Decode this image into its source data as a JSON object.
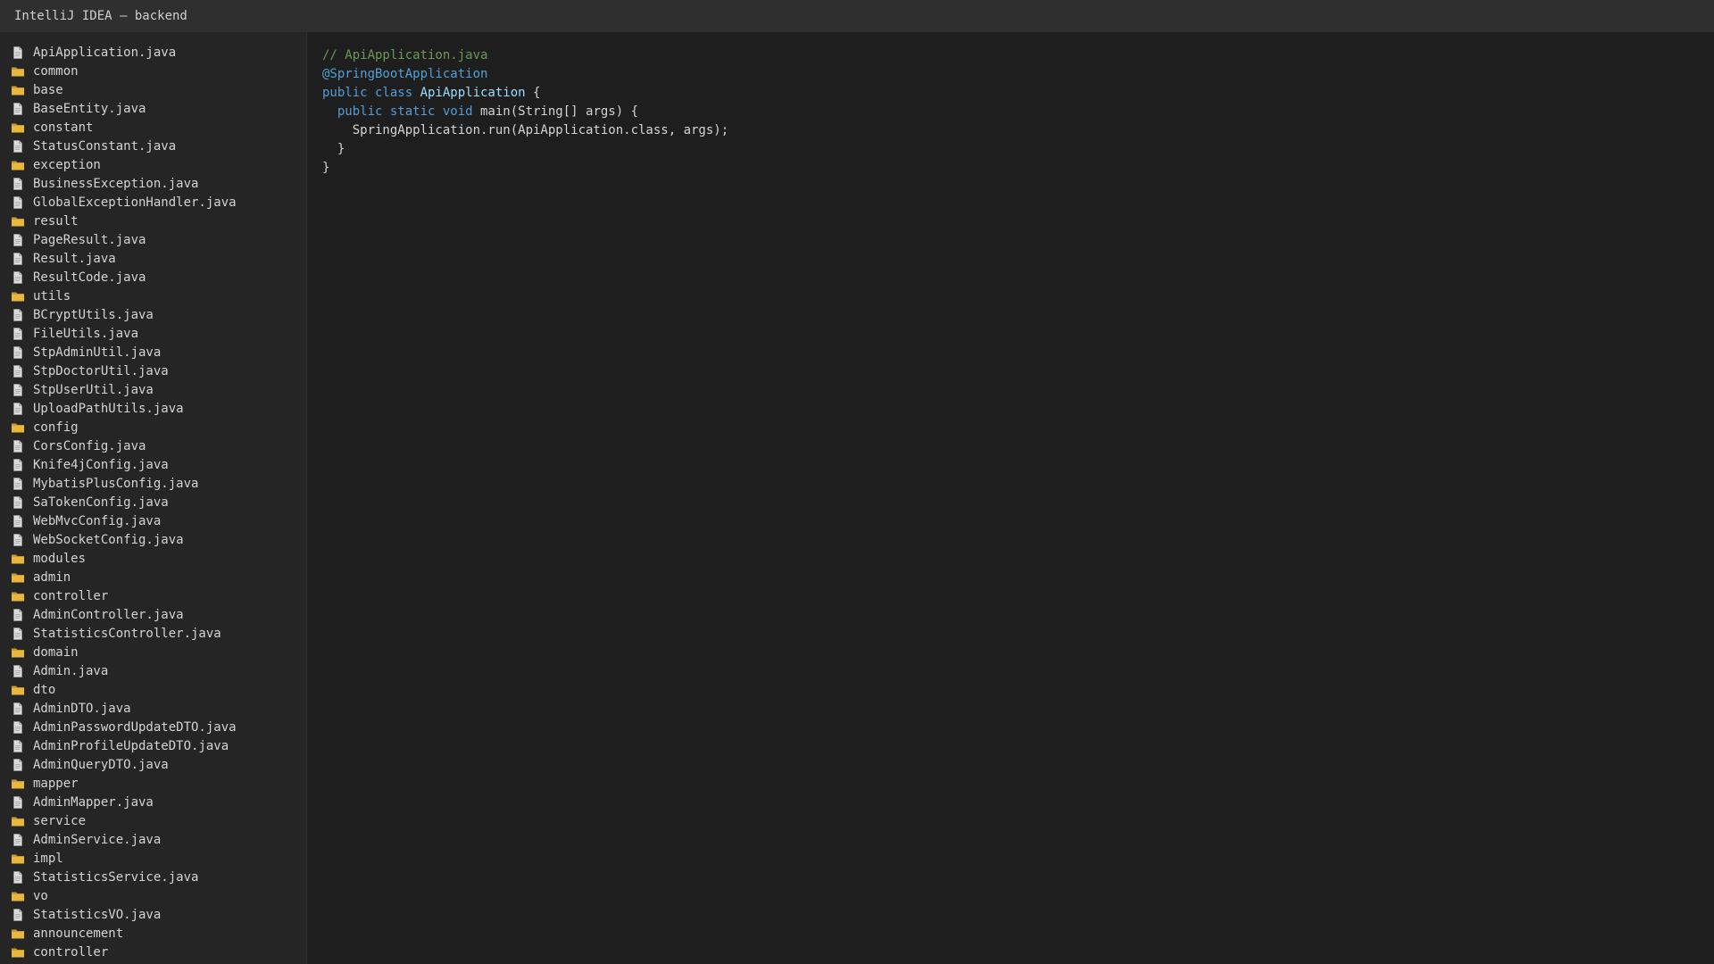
{
  "window": {
    "title": "IntelliJ IDEA — backend"
  },
  "icons": {
    "file": "file-icon",
    "folder": "folder-icon"
  },
  "colors": {
    "folder": "#e8b73c",
    "file": "#dcdcdc",
    "comment": "#6a9955",
    "annotation": "#4fa1d8",
    "keyword": "#569cd6",
    "class_name": "#9cdcfe"
  },
  "sidebar": {
    "items": [
      {
        "type": "file",
        "label": "ApiApplication.java"
      },
      {
        "type": "folder",
        "label": "common"
      },
      {
        "type": "folder",
        "label": "base"
      },
      {
        "type": "file",
        "label": "BaseEntity.java"
      },
      {
        "type": "folder",
        "label": "constant"
      },
      {
        "type": "file",
        "label": "StatusConstant.java"
      },
      {
        "type": "folder",
        "label": "exception"
      },
      {
        "type": "file",
        "label": "BusinessException.java"
      },
      {
        "type": "file",
        "label": "GlobalExceptionHandler.java"
      },
      {
        "type": "folder",
        "label": "result"
      },
      {
        "type": "file",
        "label": "PageResult.java"
      },
      {
        "type": "file",
        "label": "Result.java"
      },
      {
        "type": "file",
        "label": "ResultCode.java"
      },
      {
        "type": "folder",
        "label": "utils"
      },
      {
        "type": "file",
        "label": "BCryptUtils.java"
      },
      {
        "type": "file",
        "label": "FileUtils.java"
      },
      {
        "type": "file",
        "label": "StpAdminUtil.java"
      },
      {
        "type": "file",
        "label": "StpDoctorUtil.java"
      },
      {
        "type": "file",
        "label": "StpUserUtil.java"
      },
      {
        "type": "file",
        "label": "UploadPathUtils.java"
      },
      {
        "type": "folder",
        "label": "config"
      },
      {
        "type": "file",
        "label": "CorsConfig.java"
      },
      {
        "type": "file",
        "label": "Knife4jConfig.java"
      },
      {
        "type": "file",
        "label": "MybatisPlusConfig.java"
      },
      {
        "type": "file",
        "label": "SaTokenConfig.java"
      },
      {
        "type": "file",
        "label": "WebMvcConfig.java"
      },
      {
        "type": "file",
        "label": "WebSocketConfig.java"
      },
      {
        "type": "folder",
        "label": "modules"
      },
      {
        "type": "folder",
        "label": "admin"
      },
      {
        "type": "folder",
        "label": "controller"
      },
      {
        "type": "file",
        "label": "AdminController.java"
      },
      {
        "type": "file",
        "label": "StatisticsController.java"
      },
      {
        "type": "folder",
        "label": "domain"
      },
      {
        "type": "file",
        "label": "Admin.java"
      },
      {
        "type": "folder",
        "label": "dto"
      },
      {
        "type": "file",
        "label": "AdminDTO.java"
      },
      {
        "type": "file",
        "label": "AdminPasswordUpdateDTO.java"
      },
      {
        "type": "file",
        "label": "AdminProfileUpdateDTO.java"
      },
      {
        "type": "file",
        "label": "AdminQueryDTO.java"
      },
      {
        "type": "folder",
        "label": "mapper"
      },
      {
        "type": "file",
        "label": "AdminMapper.java"
      },
      {
        "type": "folder",
        "label": "service"
      },
      {
        "type": "file",
        "label": "AdminService.java"
      },
      {
        "type": "folder",
        "label": "impl"
      },
      {
        "type": "file",
        "label": "StatisticsService.java"
      },
      {
        "type": "folder",
        "label": "vo"
      },
      {
        "type": "file",
        "label": "StatisticsVO.java"
      },
      {
        "type": "folder",
        "label": "announcement"
      },
      {
        "type": "folder",
        "label": "controller"
      }
    ]
  },
  "editor": {
    "lines": [
      [
        {
          "t": "comment",
          "v": "// ApiApplication.java"
        }
      ],
      [
        {
          "t": "annotation",
          "v": "@SpringBootApplication"
        }
      ],
      [
        {
          "t": "keyword",
          "v": "public class "
        },
        {
          "t": "class",
          "v": "ApiApplication"
        },
        {
          "t": "plain",
          "v": " {"
        }
      ],
      [
        {
          "t": "plain",
          "v": "  "
        },
        {
          "t": "keyword",
          "v": "public static void"
        },
        {
          "t": "plain",
          "v": " main(String[] args) {"
        }
      ],
      [
        {
          "t": "plain",
          "v": "    SpringApplication.run(ApiApplication.class, args);"
        }
      ],
      [
        {
          "t": "plain",
          "v": "  }"
        }
      ],
      [
        {
          "t": "plain",
          "v": "}"
        }
      ]
    ]
  }
}
